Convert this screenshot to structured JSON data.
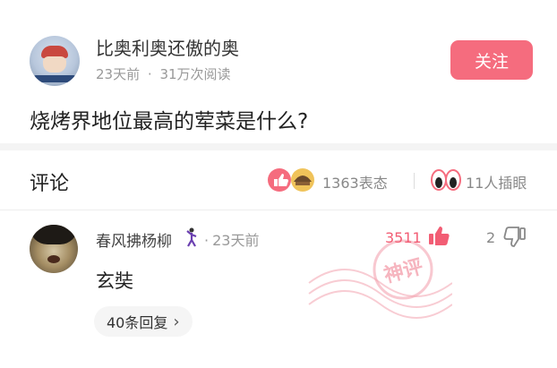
{
  "post": {
    "author_name": "比奥利奥还傲的奥",
    "time": "23天前",
    "separator": "·",
    "views": "31万次阅读",
    "follow_label": "关注",
    "question": "烧烤界地位最高的荤菜是什么?"
  },
  "comments_header": {
    "title": "评论",
    "reactions": "1363表态",
    "eyes": "11人插眼"
  },
  "comment": {
    "author": "春风拂杨柳",
    "separator": "·",
    "time": "23天前",
    "likes": "3511",
    "dislikes": "2",
    "text": "玄奘",
    "replies": "40条回复",
    "replies_chevron": "›",
    "stamp_text": "神评"
  },
  "colors": {
    "accent": "#f56c7e",
    "like": "#f25d74",
    "stamp": "#f4a3b0"
  }
}
